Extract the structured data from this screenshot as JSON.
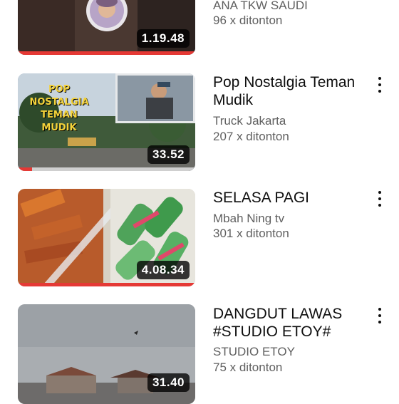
{
  "videos": [
    {
      "title": "",
      "channel": "ANA TKW SAUDI",
      "views": "96 x ditonton",
      "duration": "1.19.48",
      "progress": 1.0
    },
    {
      "title": "Pop Nostalgia Teman Mudik",
      "channel": "Truck Jakarta",
      "views": "207 x ditonton",
      "duration": "33.52",
      "progress": 0.08,
      "thumb_text": "POP NOSTALGIA TEMAN MUDIK"
    },
    {
      "title": "SELASA PAGI",
      "channel": "Mbah Ning tv",
      "views": "301 x ditonton",
      "duration": "4.08.34",
      "progress": 1.0
    },
    {
      "title": "DANGDUT LAWAS #STUDIO ETOY#",
      "channel": "STUDIO ETOY",
      "views": "75 x ditonton",
      "duration": "31.40",
      "progress": 0
    }
  ],
  "colors": {
    "accent": "#e53935",
    "text_primary": "#0f0f0f",
    "text_secondary": "#606060"
  },
  "icons": {
    "more": "more-vert-icon"
  }
}
